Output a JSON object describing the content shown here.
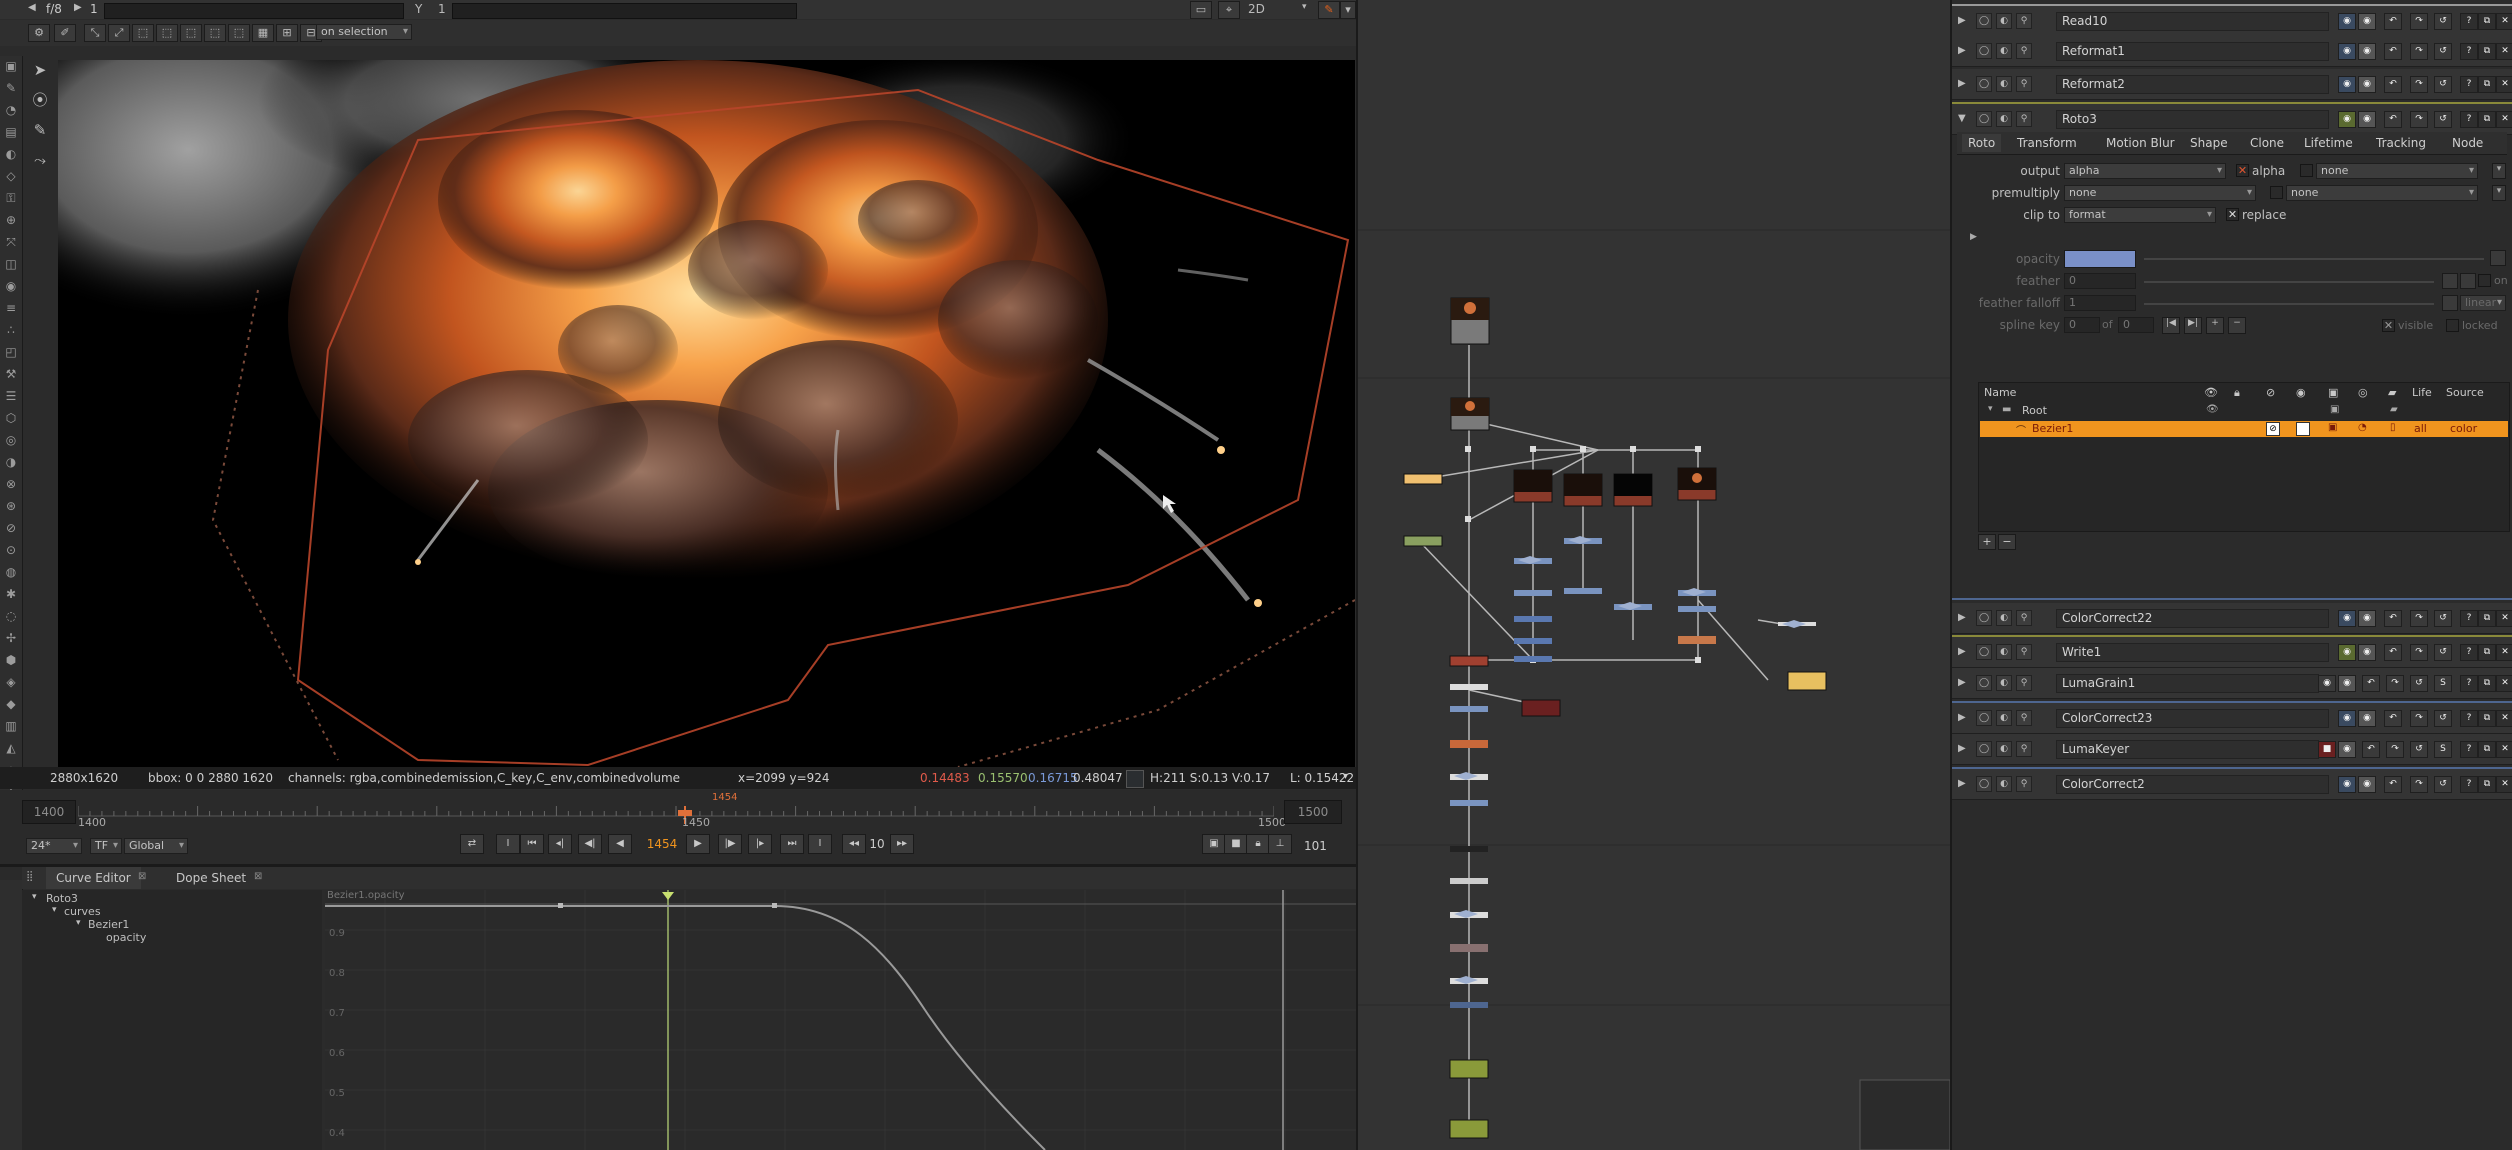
{
  "viewer_toolbar": {
    "row1": {
      "frame_ratio": "f/8",
      "frame_field": "1",
      "y_label": "Y",
      "y_value": "1",
      "view_mode": "2D"
    },
    "row2": {
      "roi_dropdown": "on selection"
    }
  },
  "viewer": {
    "info": {
      "format": "2880x1620",
      "bbox": "bbox: 0 0 2880 1620",
      "channels": "channels: rgba,combinedemission,C_key,C_env,combinedvolume",
      "coords": "x=2099 y=924",
      "r": "0.14483",
      "g": "0.15570",
      "b": "0.16715",
      "a": "0.48047",
      "hsv": "H:211 S:0.13 V:0.17",
      "luma": "L: 0.15422"
    }
  },
  "timeline": {
    "start": "1400",
    "start_label": "1400",
    "mid_label": "1450",
    "end_label": "1500",
    "end": "1500",
    "current_marker": "1454",
    "fps": "24*",
    "tf": "TF",
    "global": "Global",
    "current_frame": "1454",
    "step": "10",
    "end_frame": "101"
  },
  "curve_editor": {
    "tabs": [
      "Curve Editor",
      "Dope Sheet"
    ],
    "tree": [
      "Roto3",
      "curves",
      "Bezier1",
      "opacity"
    ],
    "curve_title": "Bezier1.opacity",
    "y_ticks": [
      "0.9",
      "0.8",
      "0.7",
      "0.6",
      "0.5",
      "0.4"
    ]
  },
  "properties": {
    "nodes_top": [
      "Read10",
      "Reformat1",
      "Reformat2",
      "Roto3"
    ],
    "roto_tabs": [
      "Roto",
      "Transform",
      "Motion Blur",
      "Shape",
      "Clone",
      "Lifetime",
      "Tracking",
      "Node"
    ],
    "output_label": "output",
    "output_value": "alpha",
    "output_check": "alpha",
    "output_none": "none",
    "premult_label": "premultiply",
    "premult_value": "none",
    "premult_none": "none",
    "clip_label": "clip to",
    "clip_value": "format",
    "replace_label": "replace",
    "opacity_label": "opacity",
    "feather_label": "feather",
    "feather_value": "0",
    "feather_on": "on",
    "falloff_label": "feather falloff",
    "falloff_value": "1",
    "falloff_dd": "linear",
    "splinekey_label": "spline key",
    "splinekey_value": "0",
    "splinekey_of": "of",
    "splinekey_total": "0",
    "visible_label": "visible",
    "locked_label": "locked",
    "layer_headers": {
      "name": "Name",
      "life": "Life",
      "source": "Source"
    },
    "layers": [
      {
        "name": "Root"
      },
      {
        "name": "Bezier1",
        "life": "all",
        "source": "color"
      }
    ],
    "nodes_bottom": [
      "ColorCorrect22",
      "Write1",
      "LumaGrain1",
      "ColorCorrect23",
      "LumaKeyer",
      "ColorCorrect2"
    ]
  },
  "colors": {
    "accent_orange": "#f0941e",
    "roto_outline": "#8a8a3a",
    "node_separator_blue": "#4e6690"
  }
}
